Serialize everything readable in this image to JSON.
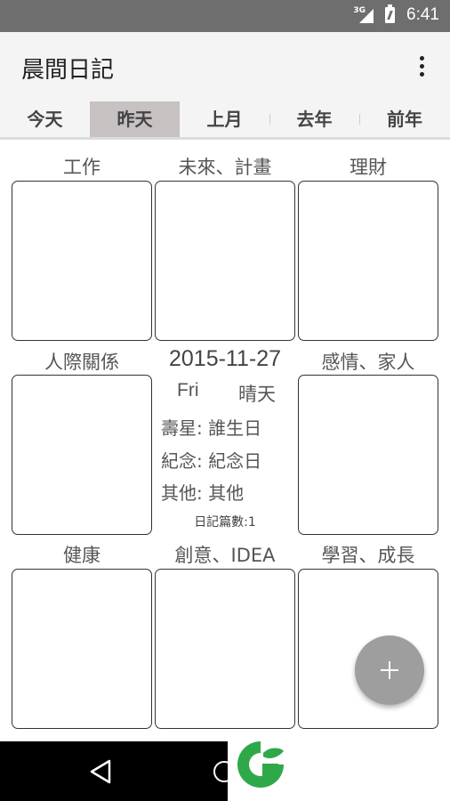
{
  "status_bar": {
    "network": "3G",
    "time": "6:41"
  },
  "app_bar": {
    "title": "晨間日記",
    "menu_icon": "overflow-menu-icon"
  },
  "tabs": [
    {
      "label": "今天",
      "active": false
    },
    {
      "label": "昨天",
      "active": true
    },
    {
      "label": "上月",
      "active": false
    },
    {
      "label": "去年",
      "active": false
    },
    {
      "label": "前年",
      "active": false
    }
  ],
  "categories": {
    "work": "工作",
    "future_plan": "未來、計畫",
    "finance": "理財",
    "relationships": "人際關係",
    "feelings_family": "感情、家人",
    "health": "健康",
    "creativity": "創意、IDEA",
    "learning": "學習、成長"
  },
  "day_info": {
    "date": "2015-11-27",
    "weekday": "Fri",
    "weather": "晴天",
    "birthday_line": "壽星: 誰生日",
    "anniversary_line": "紀念: 紀念日",
    "other_line": "其他: 其他",
    "diary_count": "日記篇數:1"
  },
  "fab": {
    "icon": "plus-icon"
  },
  "nav_bar": {
    "back_icon": "back-icon",
    "home_icon": "home-icon"
  },
  "colors": {
    "active_tab": "#c7c1c1",
    "fab": "#9e9e9e",
    "logo_green": "#2fa84a"
  }
}
